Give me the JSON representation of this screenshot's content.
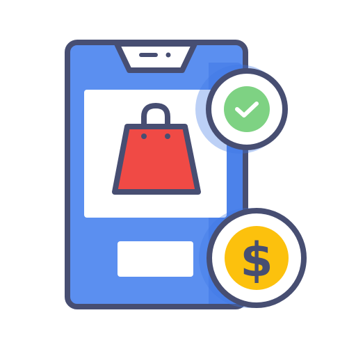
{
  "illustration": {
    "icons": {
      "phone": "smartphone-icon",
      "bag": "shopping-bag-icon",
      "check": "checkmark-badge-icon",
      "coin": "dollar-coin-icon"
    },
    "coin_symbol": "$"
  },
  "colors": {
    "outline": "#474e72",
    "phone_body": "#5b8ff0",
    "phone_shadow": "#3f78e6",
    "screen": "#ffffff",
    "bag": "#f04a45",
    "check_fill": "#7ed283",
    "coin_fill": "#fcc10d",
    "badge_shadow": "#e9ebf2"
  }
}
